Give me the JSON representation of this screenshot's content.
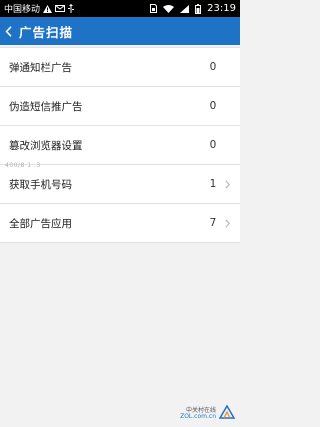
{
  "statusbar": {
    "carrier": "中国移动",
    "time": "23:19"
  },
  "header": {
    "title": "广告扫描"
  },
  "rows": [
    {
      "label": "弹通知栏广告",
      "count": "0",
      "chevron": false
    },
    {
      "label": "伪造短信推广告",
      "count": "0",
      "chevron": false
    },
    {
      "label": "篡改浏览器设置",
      "count": "0",
      "chevron": false
    },
    {
      "label": "获取手机号码",
      "count": "1",
      "chevron": true
    },
    {
      "label": "全部广告应用",
      "count": "7",
      "chevron": true
    }
  ],
  "watermark": {
    "overlay": "400/8 1 .3",
    "cn": "中关村在线",
    "en": "ZOL.com.cn"
  },
  "colors": {
    "header_bg": "#1e73c7",
    "statusbar_bg": "#000000",
    "page_bg": "#f2f2f2"
  },
  "icons": [
    "alert-icon",
    "envelope-icon",
    "usb-icon",
    "sim-icon",
    "wifi-icon",
    "signal-icon",
    "battery-icon",
    "back-arrow-icon",
    "chevron-right-icon"
  ]
}
